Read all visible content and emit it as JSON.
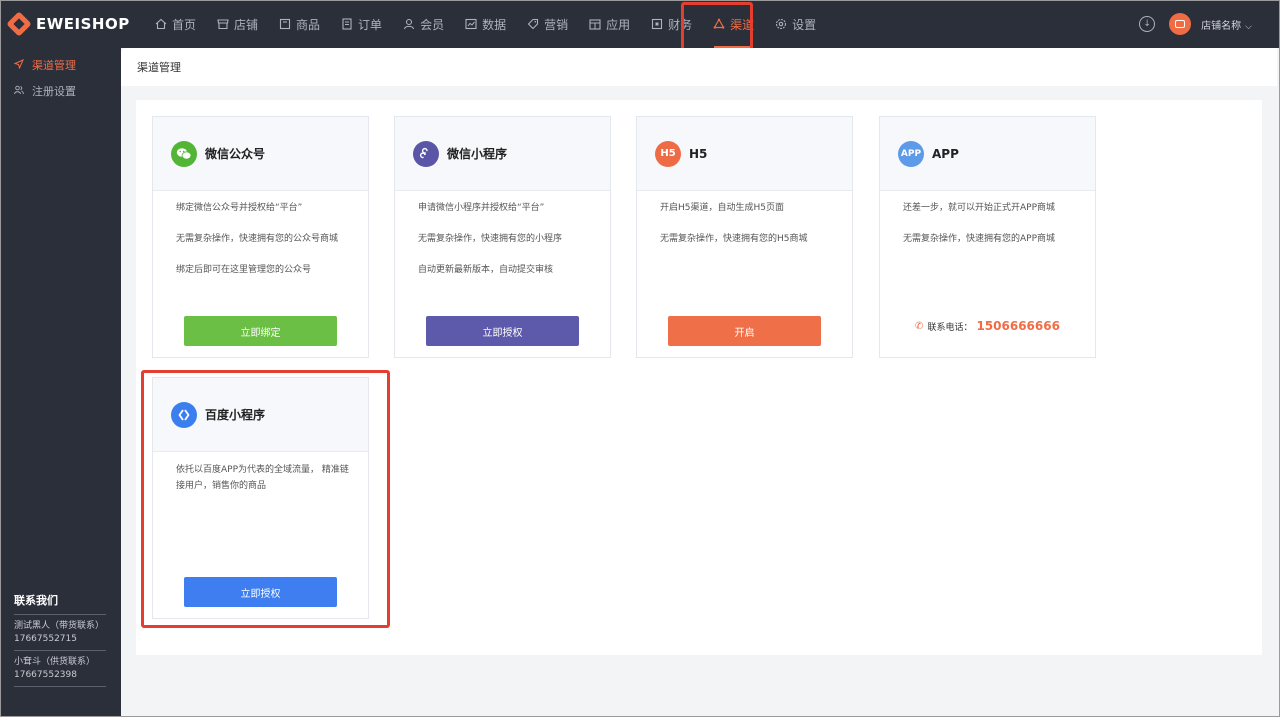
{
  "brand": {
    "name": "EWEISHOP"
  },
  "nav": [
    {
      "label": "首页",
      "icon": "home-icon"
    },
    {
      "label": "店铺",
      "icon": "store-icon"
    },
    {
      "label": "商品",
      "icon": "goods-icon"
    },
    {
      "label": "订单",
      "icon": "order-icon"
    },
    {
      "label": "会员",
      "icon": "member-icon"
    },
    {
      "label": "数据",
      "icon": "data-chart-icon"
    },
    {
      "label": "营销",
      "icon": "tag-icon"
    },
    {
      "label": "应用",
      "icon": "app-icon"
    },
    {
      "label": "财务",
      "icon": "finance-icon"
    },
    {
      "label": "渠道",
      "icon": "channel-icon",
      "active": true
    },
    {
      "label": "设置",
      "icon": "settings-icon"
    }
  ],
  "header": {
    "shop_name": "店铺名称"
  },
  "sidebar": {
    "items": [
      {
        "label": "渠道管理",
        "icon": "send-icon",
        "active": true
      },
      {
        "label": "注册设置",
        "icon": "users-icon"
      }
    ],
    "contact": {
      "title": "联系我们",
      "entries": [
        {
          "name": "测试黑人（带货联系）",
          "phone": "17667552715"
        },
        {
          "name": "小耷斗（供货联系）",
          "phone": "17667552398"
        }
      ]
    }
  },
  "breadcrumb": "渠道管理",
  "cards": [
    {
      "title": "微信公众号",
      "icon": "wechat-icon",
      "color": "#52b535",
      "lines": [
        "绑定微信公众号并授权给“平台”",
        "无需复杂操作，快速拥有您的公众号商城",
        "绑定后即可在这里管理您的公众号"
      ],
      "button": "立即绑定",
      "button_color": "#6cbf45"
    },
    {
      "title": "微信小程序",
      "icon": "mini-program-icon",
      "color": "#5b55a8",
      "lines": [
        "申请微信小程序并授权给“平台”",
        "无需复杂操作，快速拥有您的小程序",
        "自动更新最新版本，自动提交审核"
      ],
      "button": "立即授权",
      "button_color": "#5e5aab"
    },
    {
      "title": "H5",
      "icon": "h5-icon",
      "icon_text": "H5",
      "color": "#ee6c45",
      "lines": [
        "开启H5渠道，自动生成H5页面",
        "无需复杂操作，快速拥有您的H5商城"
      ],
      "button": "开启",
      "button_color": "#ee6f48"
    },
    {
      "title": "APP",
      "icon": "app-badge-icon",
      "icon_text": "APP",
      "color": "#5d9ae8",
      "lines": [
        "还差一步，就可以开始正式开APP商城",
        "无需复杂操作，快速拥有您的APP商城"
      ],
      "phone_label": "联系电话：",
      "phone": "1506666666"
    },
    {
      "title": "百度小程序",
      "icon": "baidu-icon",
      "color": "#3a7ef0",
      "lines": [
        "依托以百度APP为代表的全域流量， 精准链接用户，销售你的商品"
      ],
      "button": "立即授权",
      "button_color": "#3e7ef0"
    }
  ]
}
